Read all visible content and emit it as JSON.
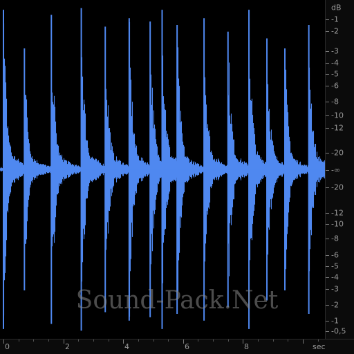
{
  "colors": {
    "background": "#000000",
    "waveform": "#4f88f0",
    "scale_text": "#9a9a9a",
    "axis_bg": "#0b0b0b"
  },
  "db_scale": {
    "unit": "dB",
    "labels": [
      "-1",
      "-2",
      "-3",
      "-4",
      "-5",
      "-6",
      "-8",
      "-10",
      "-12",
      "-20",
      "-∞",
      "-20",
      "-12",
      "-10",
      "-8",
      "-6",
      "-5",
      "-4",
      "-3",
      "-2",
      "-1",
      "-0,5"
    ]
  },
  "time_axis": {
    "unit": "sec",
    "labels": [
      "0",
      "2",
      "4",
      "6",
      "8"
    ]
  },
  "waveform": {
    "hit_times_sec": [
      0.0,
      0.7,
      1.6,
      2.6,
      3.4,
      4.2,
      4.9,
      5.3,
      5.8,
      6.7,
      7.5,
      8.2,
      8.8,
      9.4,
      10.2
    ],
    "hit_levels": [
      0.95,
      0.72,
      0.92,
      0.96,
      0.85,
      0.9,
      0.88,
      0.95,
      0.86,
      0.9,
      0.82,
      0.95,
      0.78,
      0.72,
      0.86
    ],
    "duration_sec": 10.9
  },
  "watermark": {
    "text": "Sound-Pack.Net"
  }
}
